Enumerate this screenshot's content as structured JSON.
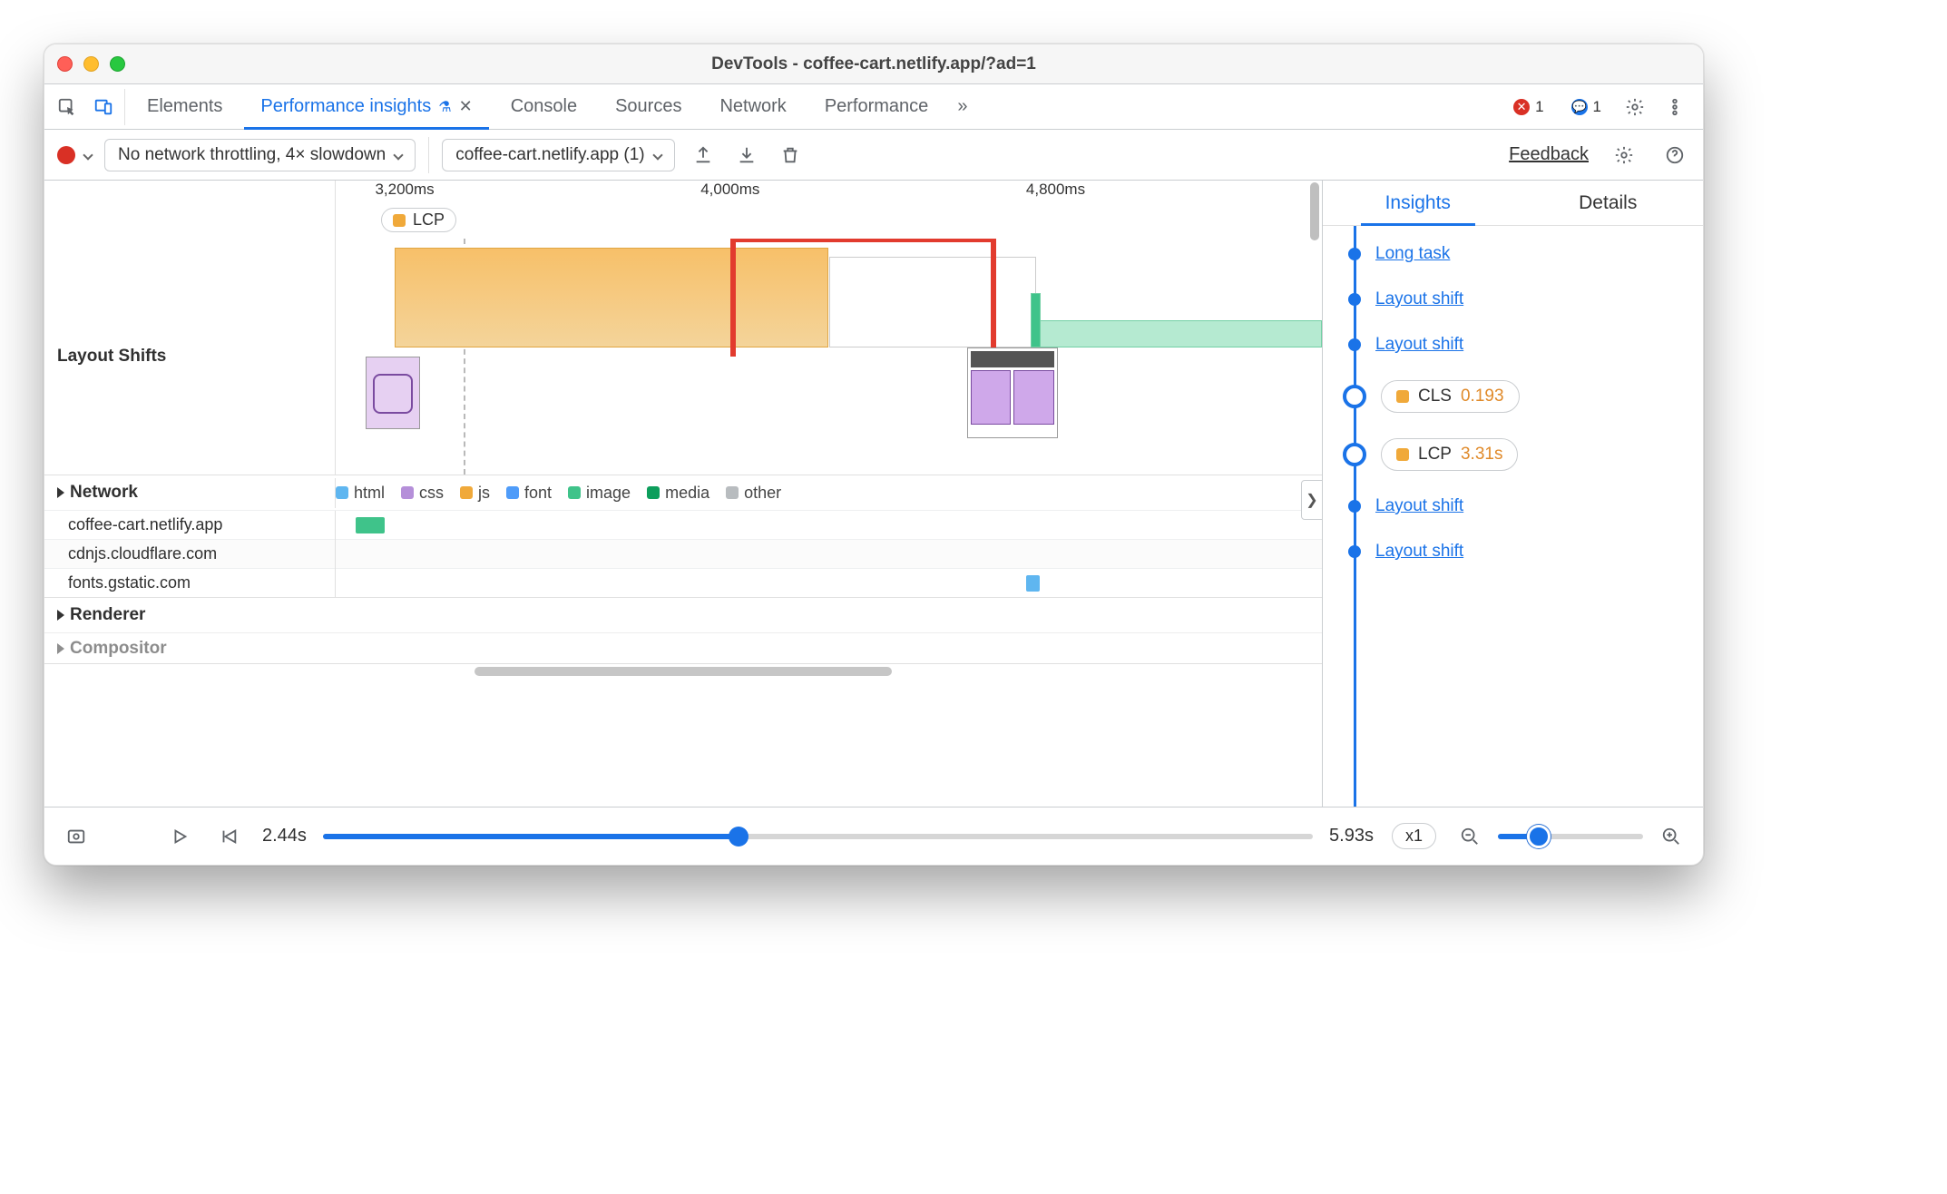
{
  "window": {
    "title": "DevTools - coffee-cart.netlify.app/?ad=1"
  },
  "tabs": {
    "items": [
      "Elements",
      "Performance insights",
      "Console",
      "Sources",
      "Network",
      "Performance"
    ],
    "active_index": 1,
    "overflow_glyph": "»",
    "close_glyph": "✕",
    "flask_glyph": "⚗"
  },
  "status": {
    "errors": "1",
    "messages": "1"
  },
  "toolbar": {
    "throttle_label": "No network throttling, 4× slowdown",
    "page_select": "coffee-cart.netlify.app (1)",
    "feedback": "Feedback"
  },
  "ruler": {
    "ticks": [
      {
        "label": "3,200ms",
        "left_pct": 4
      },
      {
        "label": "4,000ms",
        "left_pct": 37
      },
      {
        "label": "4,800ms",
        "left_pct": 70
      }
    ],
    "lcp_pill": "LCP"
  },
  "rows": {
    "layout_shifts": "Layout Shifts",
    "network": "Network",
    "renderer": "Renderer",
    "compositor": "Compositor"
  },
  "legend": {
    "html": "html",
    "css": "css",
    "js": "js",
    "font": "font",
    "image": "image",
    "media": "media",
    "other": "other"
  },
  "network_rows": [
    "coffee-cart.netlify.app",
    "cdnjs.cloudflare.com",
    "fonts.gstatic.com"
  ],
  "sidebar": {
    "tabs": {
      "insights": "Insights",
      "details": "Details"
    },
    "items": [
      {
        "kind": "link",
        "label": "Long task"
      },
      {
        "kind": "link",
        "label": "Layout shift"
      },
      {
        "kind": "link",
        "label": "Layout shift"
      },
      {
        "kind": "pill",
        "color": "orange",
        "name": "CLS",
        "value": "0.193"
      },
      {
        "kind": "pill",
        "color": "orange",
        "name": "LCP",
        "value": "3.31s"
      },
      {
        "kind": "link",
        "label": "Layout shift"
      },
      {
        "kind": "link",
        "label": "Layout shift"
      }
    ]
  },
  "footer": {
    "start": "2.44s",
    "end": "5.93s",
    "zoom": "x1",
    "slider_pct": 42,
    "zoom_slider_pct": 28
  }
}
